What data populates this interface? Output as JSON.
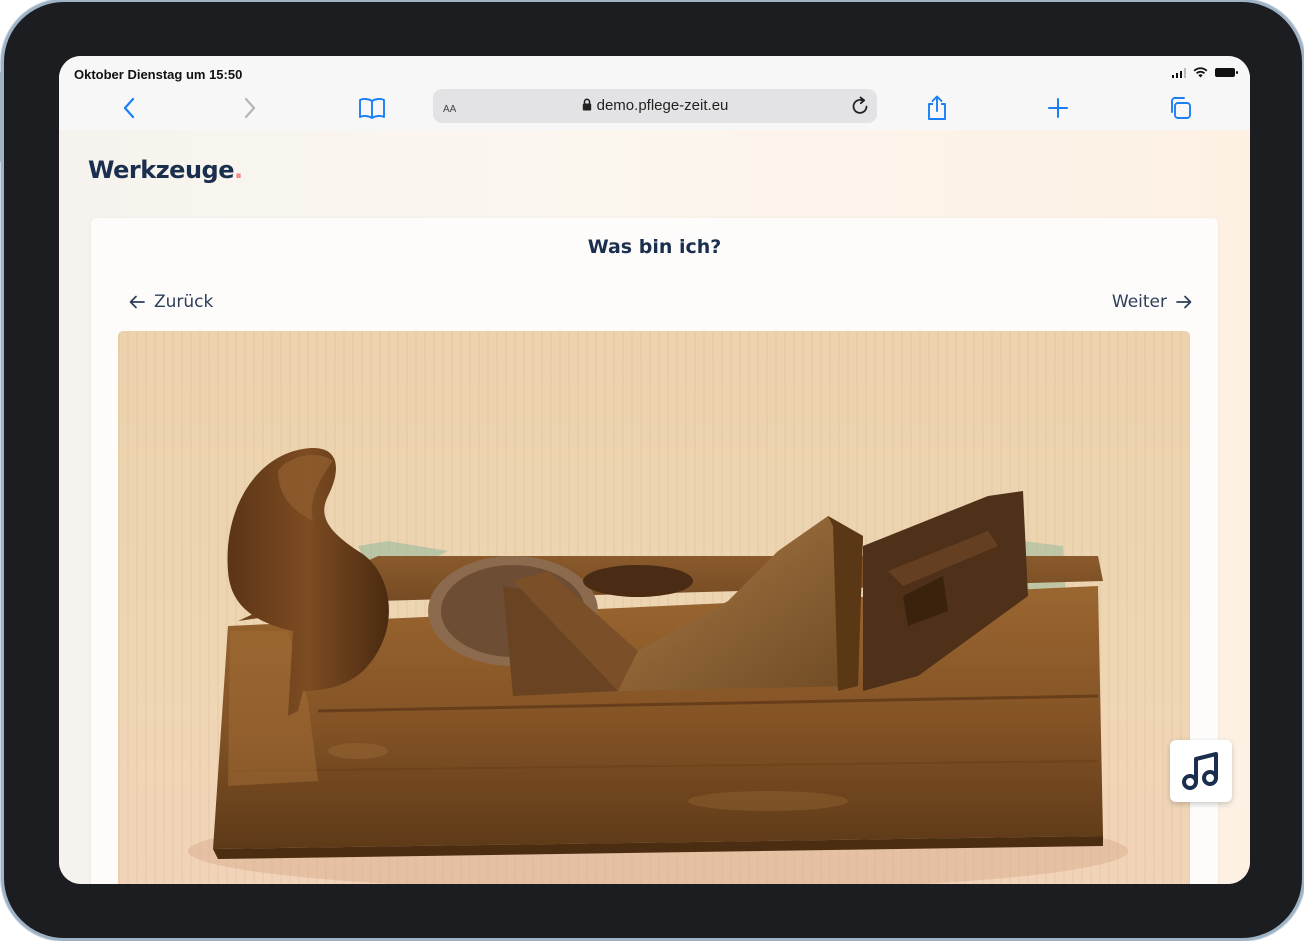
{
  "status_bar": {
    "time": "Oktober Dienstag um 15:50"
  },
  "browser": {
    "text_size_label": "AA",
    "url": "demo.pflege-zeit.eu",
    "icons": [
      "back-icon",
      "forward-icon",
      "bookmarks-icon",
      "lock-icon",
      "reload-icon",
      "share-icon",
      "plus-icon",
      "tabs-icon"
    ],
    "accent_color": "#1a7ef5"
  },
  "page": {
    "brand": "Werkzeuge",
    "brand_dot": ".",
    "brand_color": "#1a2e4e",
    "brand_dot_color": "#f28b8b",
    "quiz": {
      "title": "Was bin ich?",
      "back_label": "Zurück",
      "next_label": "Weiter",
      "image_alt": "Alter Holzhobel"
    },
    "music_button_icon": "music-note-icon"
  }
}
